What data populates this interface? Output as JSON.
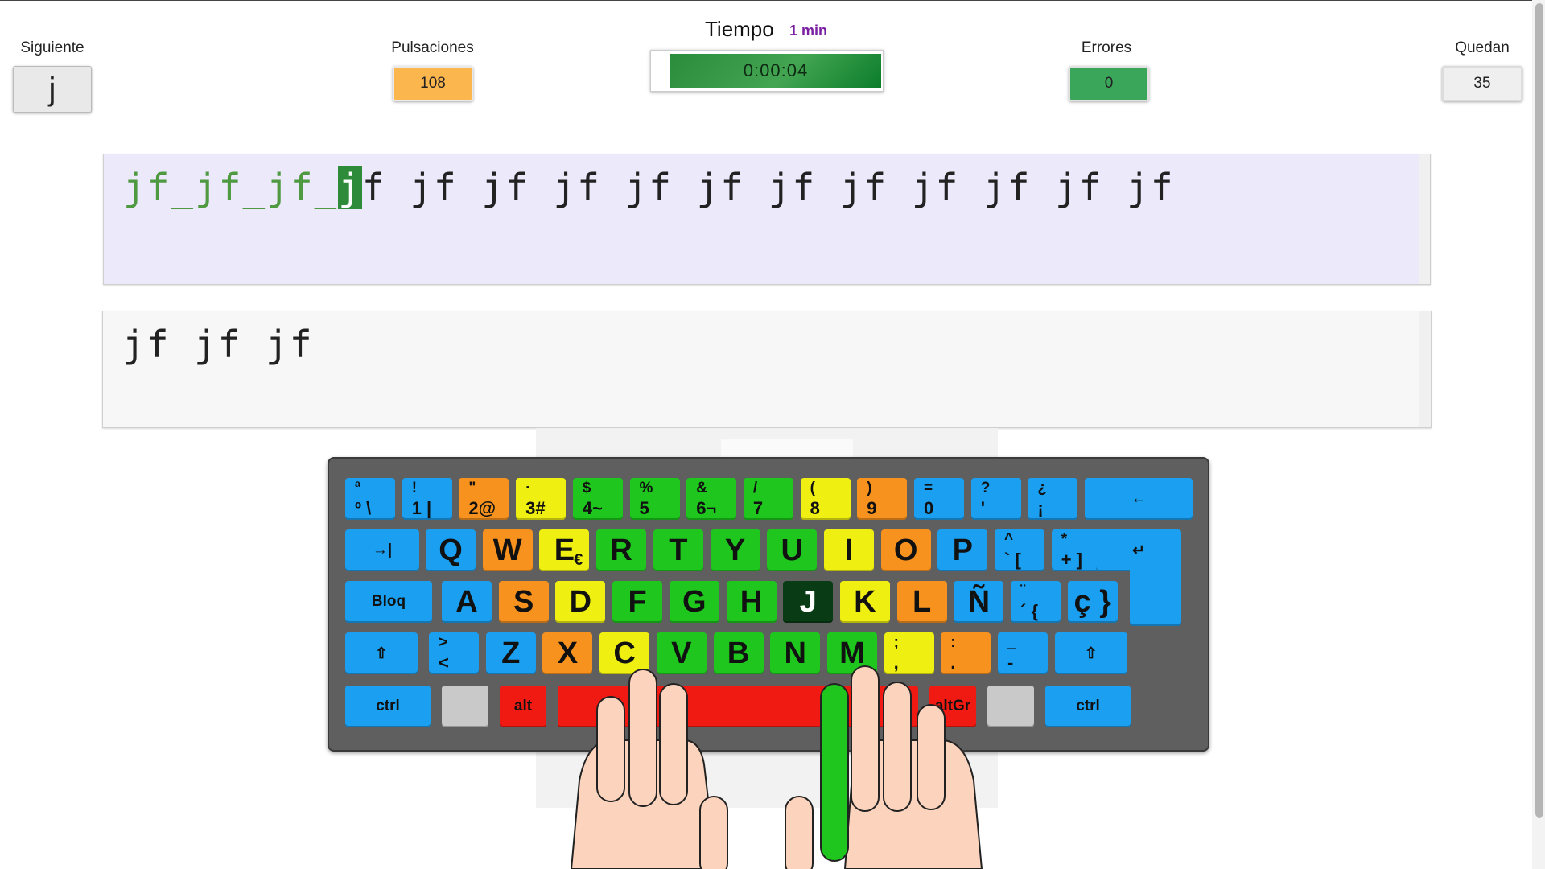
{
  "stats": {
    "next_label": "Siguiente",
    "next_value": "j",
    "presses_label": "Pulsaciones",
    "presses_value": "108",
    "time_label": "Tiempo",
    "time_limit": "1 min",
    "time_value": "0:00:04",
    "errors_label": "Errores",
    "errors_value": "0",
    "remaining_label": "Quedan",
    "remaining_value": "35"
  },
  "exercise": {
    "done_text": "jf_jf_jf_",
    "cursor_char": "j",
    "pending_text": "f jf jf jf jf jf jf jf jf jf jf jf",
    "typed_text": "jf jf jf"
  },
  "keyboard": {
    "highlighted_key": "J",
    "colors": {
      "blue": "#1b9ff0",
      "orange": "#f7921e",
      "yellow": "#eff012",
      "green": "#1ec61e",
      "red": "#f11a12",
      "highlight": "#093c15"
    },
    "row1": [
      {
        "top": "ª",
        "bot": "º \\",
        "color": "blue"
      },
      {
        "top": "!",
        "bot": "1 |",
        "color": "blue"
      },
      {
        "top": "\"",
        "bot": "2@",
        "color": "orange"
      },
      {
        "top": "·",
        "bot": "3#",
        "color": "yellow"
      },
      {
        "top": "$",
        "bot": "4~",
        "color": "green"
      },
      {
        "top": "%",
        "bot": "5",
        "color": "green"
      },
      {
        "top": "&",
        "bot": "6¬",
        "color": "green"
      },
      {
        "top": "/",
        "bot": "7",
        "color": "green"
      },
      {
        "top": "(",
        "bot": "8",
        "color": "yellow"
      },
      {
        "top": ")",
        "bot": "9",
        "color": "orange"
      },
      {
        "top": "=",
        "bot": "0",
        "color": "blue"
      },
      {
        "top": "?",
        "bot": "'",
        "color": "blue"
      },
      {
        "top": "¿",
        "bot": "¡",
        "color": "blue"
      }
    ],
    "row2": [
      {
        "main": "Q",
        "color": "blue"
      },
      {
        "main": "W",
        "color": "orange"
      },
      {
        "main": "E",
        "extra": "€",
        "color": "yellow"
      },
      {
        "main": "R",
        "color": "green"
      },
      {
        "main": "T",
        "color": "green"
      },
      {
        "main": "Y",
        "color": "green"
      },
      {
        "main": "U",
        "color": "green"
      },
      {
        "main": "I",
        "color": "yellow"
      },
      {
        "main": "O",
        "color": "orange"
      },
      {
        "main": "P",
        "color": "blue"
      },
      {
        "top": "^",
        "bot": "` [",
        "color": "blue"
      },
      {
        "top": "*",
        "bot": "+ ]",
        "color": "blue"
      }
    ],
    "row3": [
      {
        "main": "A",
        "color": "blue"
      },
      {
        "main": "S",
        "color": "orange"
      },
      {
        "main": "D",
        "color": "yellow"
      },
      {
        "main": "F",
        "color": "green"
      },
      {
        "main": "G",
        "color": "green"
      },
      {
        "main": "H",
        "color": "green"
      },
      {
        "main": "J",
        "color": "dark"
      },
      {
        "main": "K",
        "color": "yellow"
      },
      {
        "main": "L",
        "color": "orange"
      },
      {
        "main": "Ñ",
        "color": "blue"
      },
      {
        "top": "¨",
        "bot": "´ {",
        "color": "blue"
      },
      {
        "main": "ç }",
        "color": "blue"
      }
    ],
    "row4": [
      {
        "top": ">",
        "bot": "<",
        "color": "blue"
      },
      {
        "main": "Z",
        "color": "blue"
      },
      {
        "main": "X",
        "color": "orange"
      },
      {
        "main": "C",
        "color": "yellow"
      },
      {
        "main": "V",
        "color": "green"
      },
      {
        "main": "B",
        "color": "green"
      },
      {
        "main": "N",
        "color": "green"
      },
      {
        "main": "M",
        "color": "green"
      },
      {
        "top": ";",
        "bot": ",",
        "color": "yellow"
      },
      {
        "top": ":",
        "bot": ".",
        "color": "orange"
      },
      {
        "top": "_",
        "bot": "-",
        "color": "blue"
      }
    ],
    "labels": {
      "backspace": "←",
      "tab": "→|",
      "enter": "↵",
      "caps": "Bloq",
      "shift": "⇧",
      "ctrl_left": "ctrl",
      "alt": "alt",
      "altgr": "altGr",
      "ctrl_right": "ctrl"
    }
  }
}
